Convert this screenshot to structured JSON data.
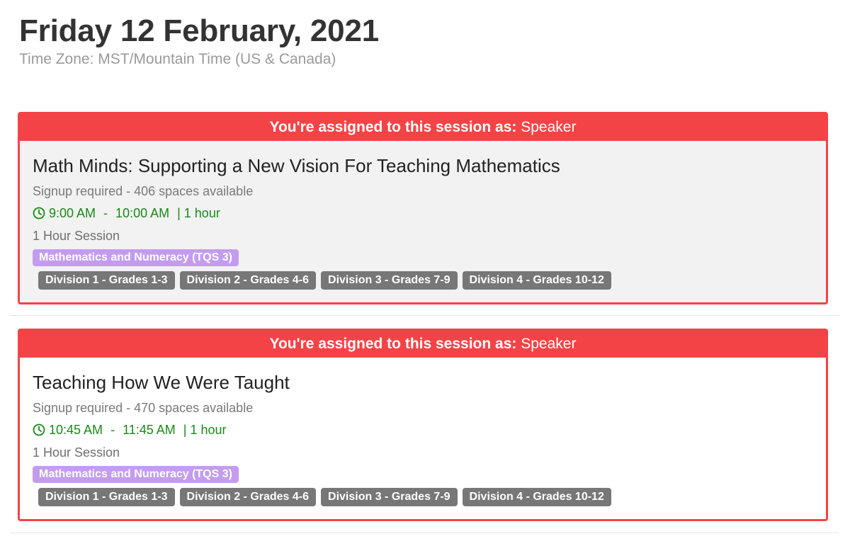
{
  "header": {
    "date": "Friday 12 February, 2021",
    "timezone": "Time Zone: MST/Mountain Time (US & Canada)"
  },
  "colors": {
    "accent_red": "#f44346",
    "time_green": "#178a17",
    "strand_purple": "#c39cf0",
    "grade_gray": "#777777"
  },
  "sessions": [
    {
      "banner_prefix": "You're assigned to this session as:",
      "banner_role": "Speaker",
      "title": "Math Minds: Supporting a New Vision For Teaching Mathematics",
      "signup": "Signup required - 406 spaces available",
      "time_icon": "clock-icon",
      "start": "9:00 AM",
      "separator": "-",
      "end": "10:00 AM",
      "duration": "| 1 hour",
      "type": "1 Hour Session",
      "strand": "Mathematics and Numeracy (TQS 3)",
      "grades": [
        "Division 1 - Grades 1-3",
        "Division 2 - Grades 4-6",
        "Division 3 - Grades 7-9",
        "Division 4 - Grades 10-12"
      ]
    },
    {
      "banner_prefix": "You're assigned to this session as:",
      "banner_role": "Speaker",
      "title": "Teaching How We Were Taught",
      "signup": "Signup required - 470 spaces available",
      "time_icon": "clock-icon",
      "start": "10:45 AM",
      "separator": "-",
      "end": "11:45 AM",
      "duration": "| 1 hour",
      "type": "1 Hour Session",
      "strand": "Mathematics and Numeracy (TQS 3)",
      "grades": [
        "Division 1 - Grades 1-3",
        "Division 2 - Grades 4-6",
        "Division 3 - Grades 7-9",
        "Division 4 - Grades 10-12"
      ]
    }
  ]
}
